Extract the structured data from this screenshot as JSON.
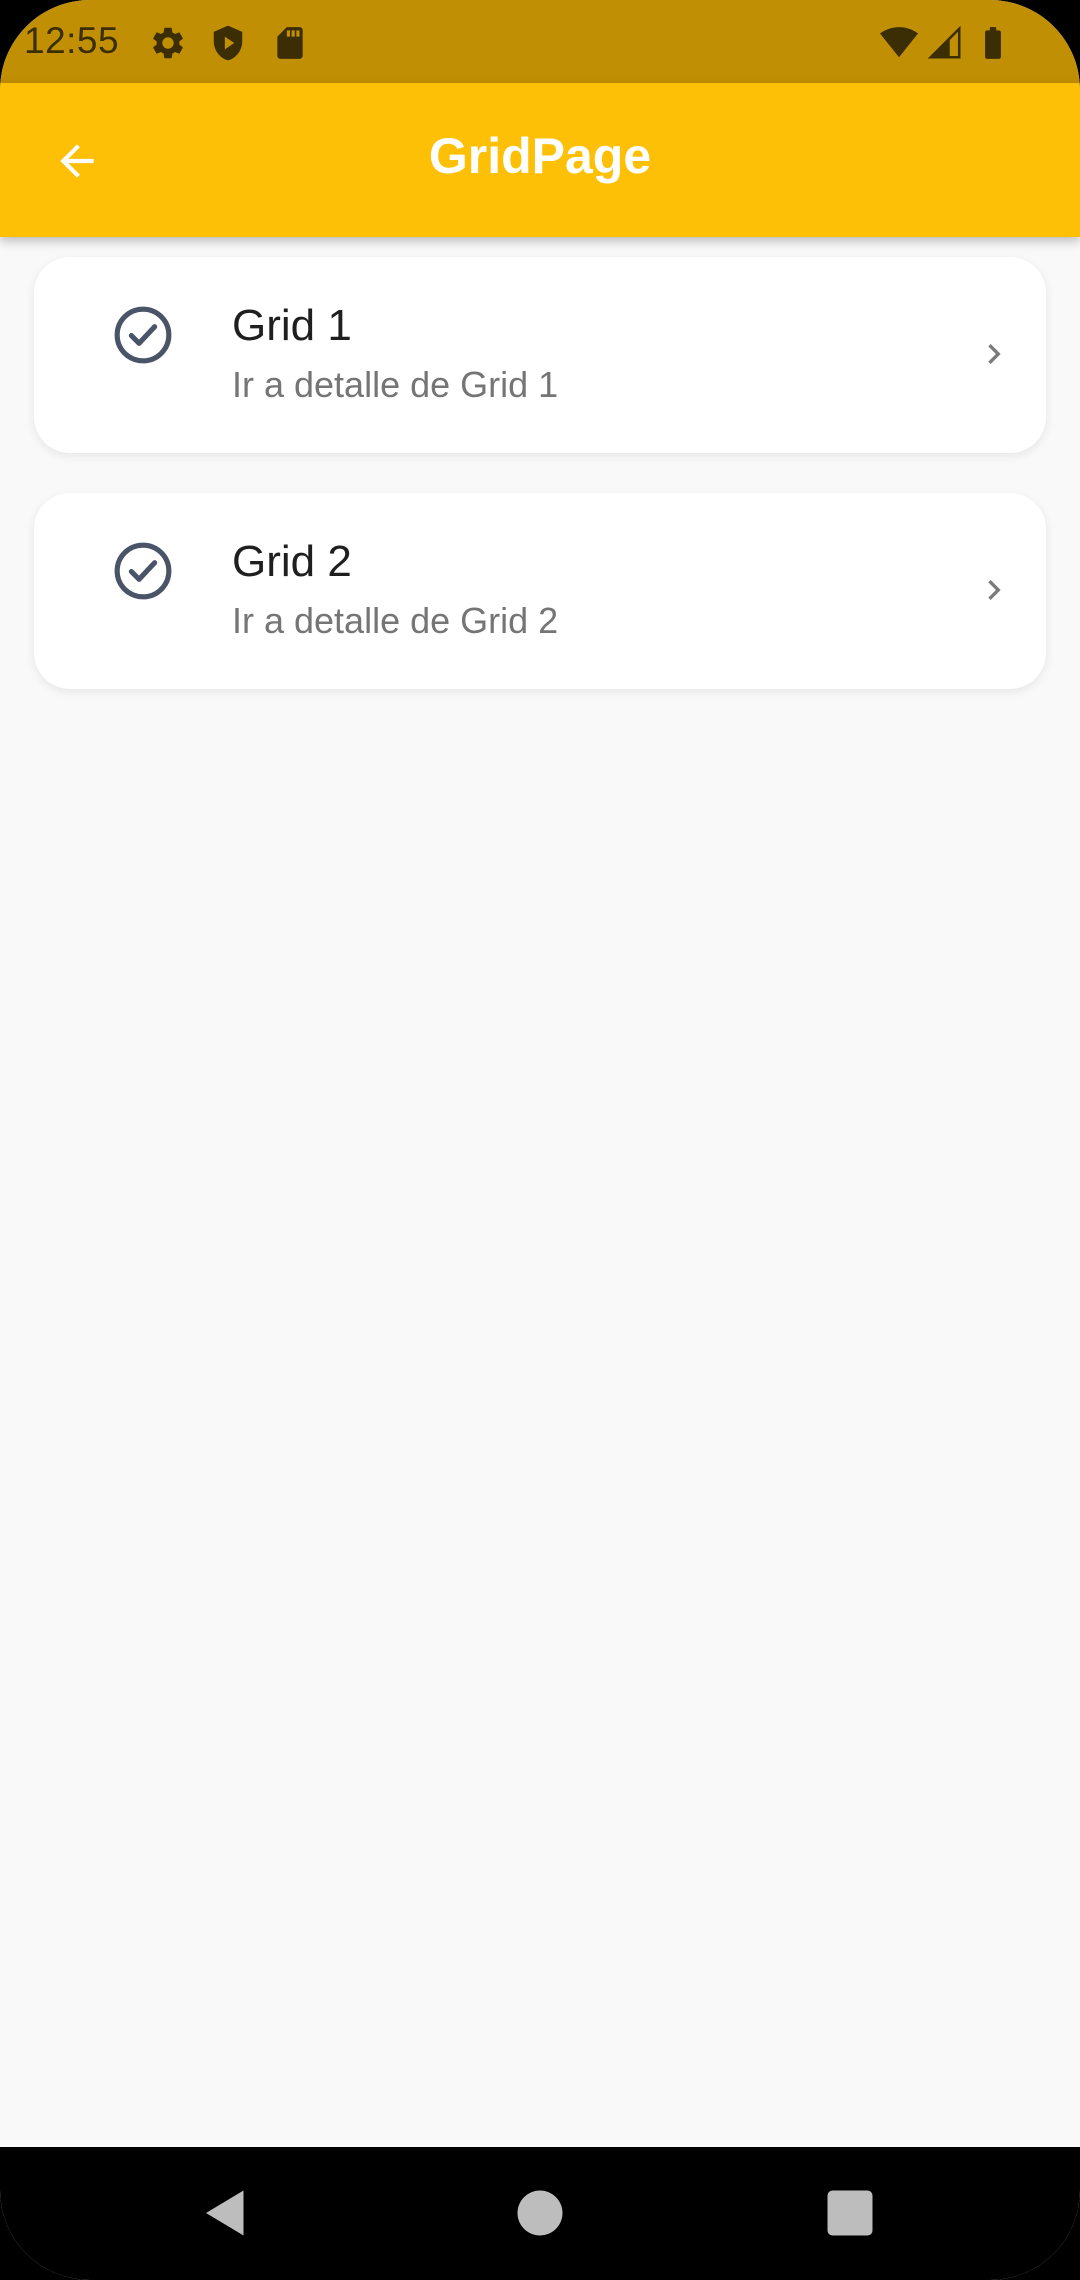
{
  "status_bar": {
    "time": "12:55",
    "background_color": "#c18f03",
    "left_icons": [
      "settings-icon",
      "shield-play-icon",
      "sd-card-icon"
    ],
    "right_icons": [
      "wifi-icon",
      "cellular-signal-icon",
      "battery-icon"
    ]
  },
  "app_bar": {
    "title": "GridPage",
    "background_color": "#fdc006",
    "back_icon": "arrow-back-icon"
  },
  "list": {
    "items": [
      {
        "title": "Grid 1",
        "subtitle": "Ir a detalle de Grid 1",
        "leading_icon": "check-circle-icon",
        "trailing_icon": "chevron-right-icon"
      },
      {
        "title": "Grid 2",
        "subtitle": "Ir a detalle de Grid 2",
        "leading_icon": "check-circle-icon",
        "trailing_icon": "chevron-right-icon"
      }
    ]
  },
  "nav_bar": {
    "buttons": [
      "back-triangle-icon",
      "home-circle-icon",
      "recents-square-icon"
    ]
  }
}
